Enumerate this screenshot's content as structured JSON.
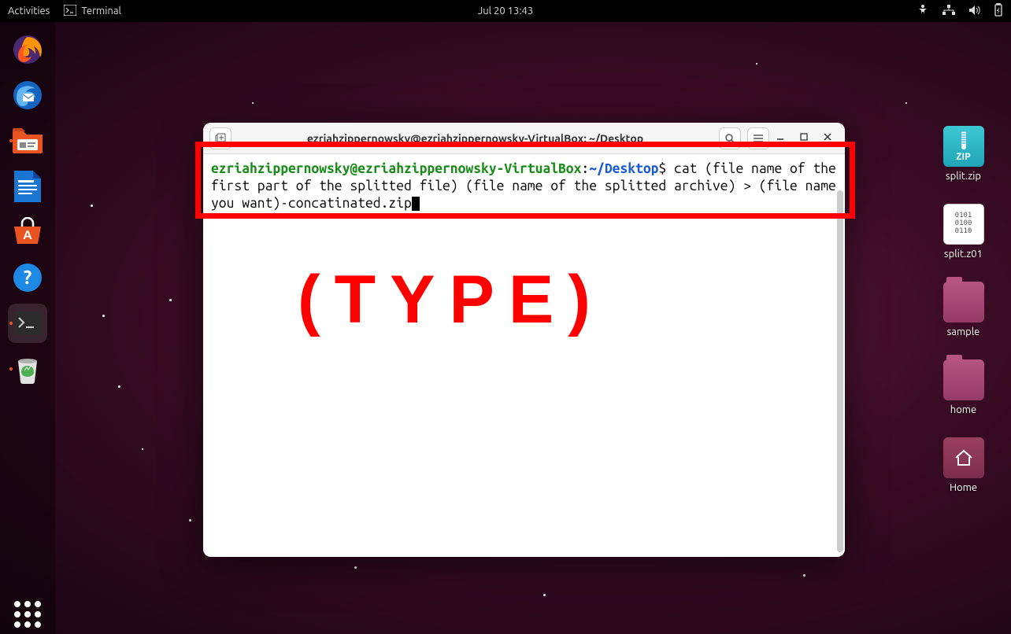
{
  "topbar": {
    "activities": "Activities",
    "app_indicator": {
      "icon": "terminal-icon",
      "label": "Terminal"
    },
    "datetime": "Jul 20  13:43"
  },
  "dock": {
    "items": [
      {
        "name": "firefox-icon",
        "active": false
      },
      {
        "name": "thunderbird-icon",
        "active": false
      },
      {
        "name": "files-icon",
        "active": true
      },
      {
        "name": "libreoffice-writer-icon",
        "active": false
      },
      {
        "name": "ubuntu-software-icon",
        "active": false
      },
      {
        "name": "help-icon",
        "active": false
      },
      {
        "name": "terminal-app-icon",
        "active": true
      },
      {
        "name": "trash-icon",
        "active": true
      }
    ]
  },
  "desktop": {
    "icons": [
      {
        "name": "split-zip",
        "label": "split.zip",
        "type": "zip",
        "badge": "ZIP"
      },
      {
        "name": "split-z01",
        "label": "split.z01",
        "type": "file",
        "badge": "0101\n0100\n0110"
      },
      {
        "name": "sample-folder",
        "label": "sample",
        "type": "folder"
      },
      {
        "name": "home-folder",
        "label": "home",
        "type": "folder"
      },
      {
        "name": "home-location",
        "label": "Home",
        "type": "home"
      }
    ]
  },
  "terminal_window": {
    "title": "ezriahzippernowsky@ezriahzippernowsky-VirtualBox: ~/Desktop",
    "prompt": {
      "userhost": "ezriahzippernowsky@ezriahzippernowsky-VirtualBox",
      "sep": ":",
      "path": "~/Desktop",
      "dollar": "$"
    },
    "command": "cat (file name of the first part of the splitted file) (file name of the splitted archive) > (file name you want)-concatinated.zip"
  },
  "annotation": {
    "label": "(TYPE)"
  }
}
